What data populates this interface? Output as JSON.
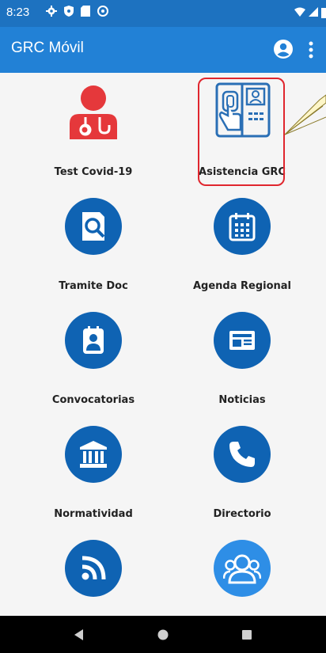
{
  "status_bar": {
    "time": "8:23"
  },
  "app_bar": {
    "title": "GRC Móvil"
  },
  "tiles": [
    {
      "label": "Test Covid-19"
    },
    {
      "label": "Asistencia GRC"
    },
    {
      "label": "Tramite Doc"
    },
    {
      "label": "Agenda Regional"
    },
    {
      "label": "Convocatorias"
    },
    {
      "label": "Noticias"
    },
    {
      "label": "Normatividad"
    },
    {
      "label": "Directorio"
    },
    {
      "label": ""
    },
    {
      "label": ""
    }
  ],
  "colors": {
    "status": "#1d72c0",
    "appbar": "#2281d6",
    "icon_blue": "#0f63b3",
    "highlight": "#e0262e"
  },
  "icons": {
    "status": [
      "gear-icon",
      "shield-icon",
      "sd-card-icon",
      "at-icon",
      "wifi-icon",
      "signal-icon",
      "battery-icon"
    ],
    "appbar": [
      "account-icon",
      "more-vert-icon"
    ],
    "tiles": [
      "doctor-icon",
      "fingerprint-terminal-icon",
      "document-search-icon",
      "calendar-icon",
      "id-badge-icon",
      "newspaper-icon",
      "courthouse-icon",
      "phone-icon",
      "rss-icon",
      "group-icon"
    ],
    "nav": [
      "back-icon",
      "home-icon",
      "recents-icon"
    ]
  }
}
